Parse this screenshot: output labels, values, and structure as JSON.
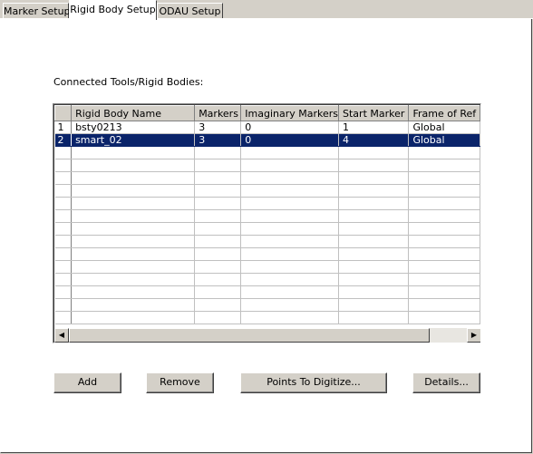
{
  "tabs": [
    {
      "label": "Marker Setup",
      "active": false
    },
    {
      "label": "Rigid Body Setup",
      "active": true
    },
    {
      "label": "ODAU Setup",
      "active": false
    }
  ],
  "section_label": "Connected Tools/Rigid Bodies:",
  "table": {
    "columns": [
      "",
      "Rigid Body Name",
      "Markers",
      "Imaginary Markers",
      "Start Marker",
      "Frame of Ref"
    ],
    "rows": [
      {
        "num": "1",
        "name": "bsty0213",
        "markers": "3",
        "imaginary": "0",
        "start": "1",
        "frame": "Global",
        "selected": false
      },
      {
        "num": "2",
        "name": "smart_02",
        "markers": "3",
        "imaginary": "0",
        "start": "4",
        "frame": "Global",
        "selected": true
      }
    ],
    "empty_row_count": 14
  },
  "scrollbar": {
    "left_icon": "scroll-left-icon",
    "right_icon": "scroll-right-icon"
  },
  "buttons": {
    "add": "Add",
    "remove": "Remove",
    "points": "Points To Digitize...",
    "details": "Details..."
  },
  "colors": {
    "face": "#d4d0c8",
    "selection": "#0a246a",
    "panel": "#ffffff"
  }
}
